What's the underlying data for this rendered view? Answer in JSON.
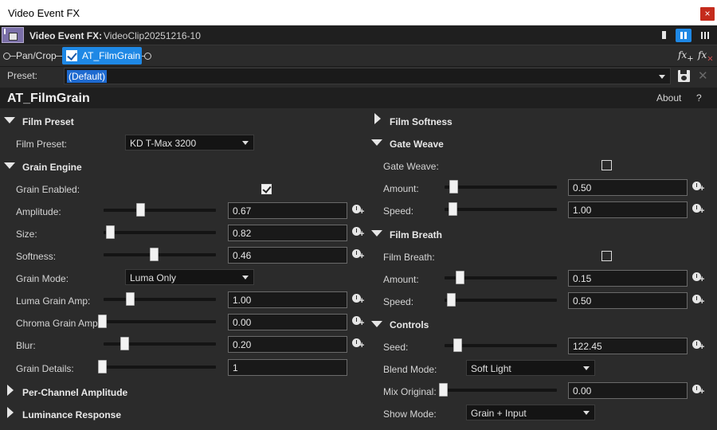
{
  "window": {
    "title": "Video Event FX",
    "close_glyph": "×"
  },
  "header": {
    "label": "Video Event FX:",
    "clip": "VideoClip20251216-10"
  },
  "chain": {
    "items": [
      {
        "label": "Pan/Crop",
        "active": false
      },
      {
        "label": "AT_FilmGrain",
        "active": true,
        "enabled": true
      }
    ],
    "fx_add": "fx",
    "fx_remove": "fx"
  },
  "preset": {
    "label": "Preset:",
    "value": "(Default)"
  },
  "plugin": {
    "name": "AT_FilmGrain",
    "about": "About",
    "help": "?"
  },
  "colors": {
    "accent": "#1e88e5",
    "close": "#c42b1c",
    "background": "#2b2b2b"
  },
  "left": {
    "film_preset": {
      "title": "Film Preset",
      "label": "Film Preset:",
      "value": "KD T-Max 3200"
    },
    "grain_engine": {
      "title": "Grain Engine",
      "grain_enabled": {
        "label": "Grain Enabled:",
        "checked": true
      },
      "amplitude": {
        "label": "Amplitude:",
        "value": "0.67"
      },
      "size": {
        "label": "Size:",
        "value": "0.82"
      },
      "softness": {
        "label": "Softness:",
        "value": "0.46"
      },
      "grain_mode": {
        "label": "Grain Mode:",
        "value": "Luma Only"
      },
      "luma_grain_amp": {
        "label": "Luma Grain Amp:",
        "value": "1.00"
      },
      "chroma_grain_amp": {
        "label": "Chroma Grain Amp:",
        "value": "0.00"
      },
      "blur": {
        "label": "Blur:",
        "value": "0.20"
      },
      "grain_details": {
        "label": "Grain Details:",
        "value": "1"
      }
    },
    "per_channel": {
      "title": "Per-Channel Amplitude"
    },
    "luminance": {
      "title": "Luminance Response"
    }
  },
  "right": {
    "film_softness": {
      "title": "Film Softness"
    },
    "gate_weave": {
      "title": "Gate Weave",
      "toggle": {
        "label": "Gate Weave:",
        "checked": false
      },
      "amount": {
        "label": "Amount:",
        "value": "0.50"
      },
      "speed": {
        "label": "Speed:",
        "value": "1.00"
      }
    },
    "film_breath": {
      "title": "Film Breath",
      "toggle": {
        "label": "Film Breath:",
        "checked": false
      },
      "amount": {
        "label": "Amount:",
        "value": "0.15"
      },
      "speed": {
        "label": "Speed:",
        "value": "0.50"
      }
    },
    "controls": {
      "title": "Controls",
      "seed": {
        "label": "Seed:",
        "value": "122.45"
      },
      "blend_mode": {
        "label": "Blend Mode:",
        "value": "Soft Light"
      },
      "mix_original": {
        "label": "Mix Original:",
        "value": "0.00"
      },
      "show_mode": {
        "label": "Show Mode:",
        "value": "Grain + Input"
      }
    }
  }
}
